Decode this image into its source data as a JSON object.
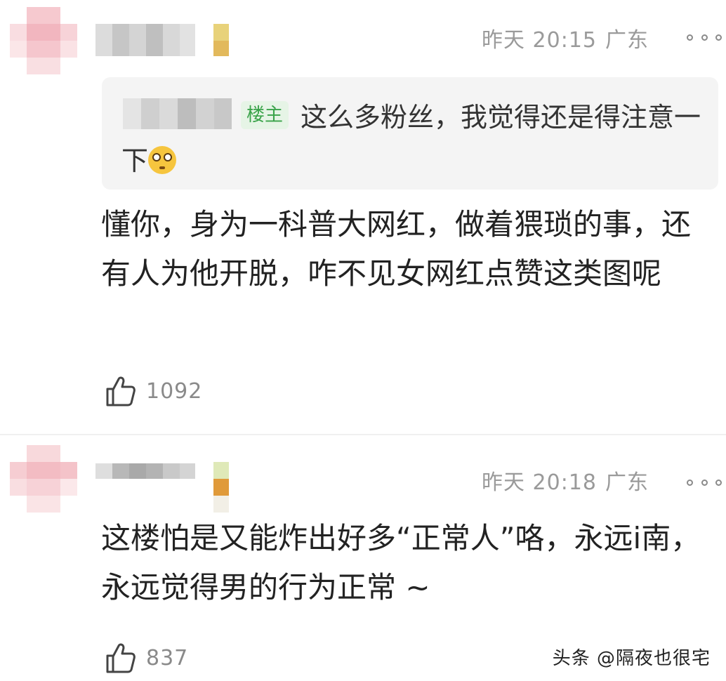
{
  "comments": [
    {
      "time": "昨天 20:15",
      "location": "广东",
      "reply": {
        "owner_badge": "楼主",
        "text": "这么多粉丝，我觉得还是得注意一下"
      },
      "content": "懂你，身为一科普大网红，做着猥琐的事，还有人为他开脱，咋不见女网红点赞这类图呢",
      "likes": "1092"
    },
    {
      "time": "昨天 20:18",
      "location": "广东",
      "content": "这楼怕是又能炸出好多“正常人”咯，永远i南，永远觉得男的行为正常 ~",
      "likes": "837"
    }
  ],
  "watermark": "头条 @隔夜也很宅",
  "colors": {
    "meta_text": "#9a9a9a",
    "owner_badge_bg": "#e6f4e6",
    "owner_badge_text": "#3aa34a",
    "quote_bg": "#f4f4f4"
  },
  "icons": [
    "thumbs-up-icon",
    "more-options-icon",
    "flushed-face-emoji"
  ]
}
